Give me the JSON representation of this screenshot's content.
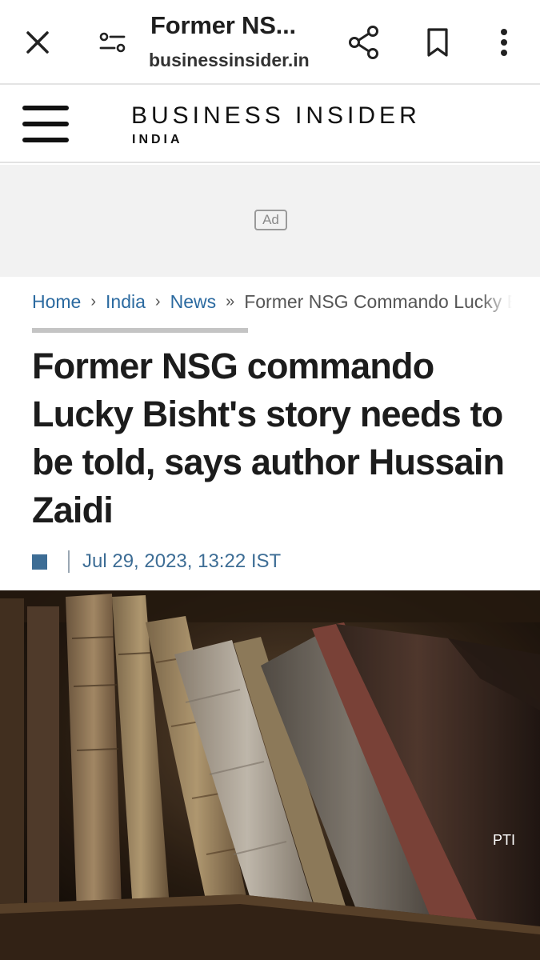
{
  "browser": {
    "title": "Former NS...",
    "url": "businessinsider.in",
    "icons": {
      "close": "close-icon",
      "site_settings": "tune-icon",
      "share": "share-icon",
      "bookmark": "bookmark-icon",
      "more": "more-vert-icon"
    }
  },
  "site": {
    "logo_main": "BUSINESS INSIDER",
    "logo_sub": "INDIA",
    "menu_icon": "hamburger-icon"
  },
  "ad": {
    "label": "Ad"
  },
  "breadcrumb": {
    "items": [
      "Home",
      "India",
      "News"
    ],
    "separators": [
      "›",
      "›",
      "»"
    ],
    "current": "Former NSG Commando Lucky Bisht"
  },
  "article": {
    "headline": "Former NSG commando Lucky Bisht's story needs to be told, says author Hussain Zaidi",
    "date": "Jul 29, 2023, 13:22 IST",
    "image_credit": "PTI"
  },
  "colors": {
    "link": "#2b6aa0",
    "meta": "#3d6d95",
    "ad_background": "#f2f2f2"
  }
}
